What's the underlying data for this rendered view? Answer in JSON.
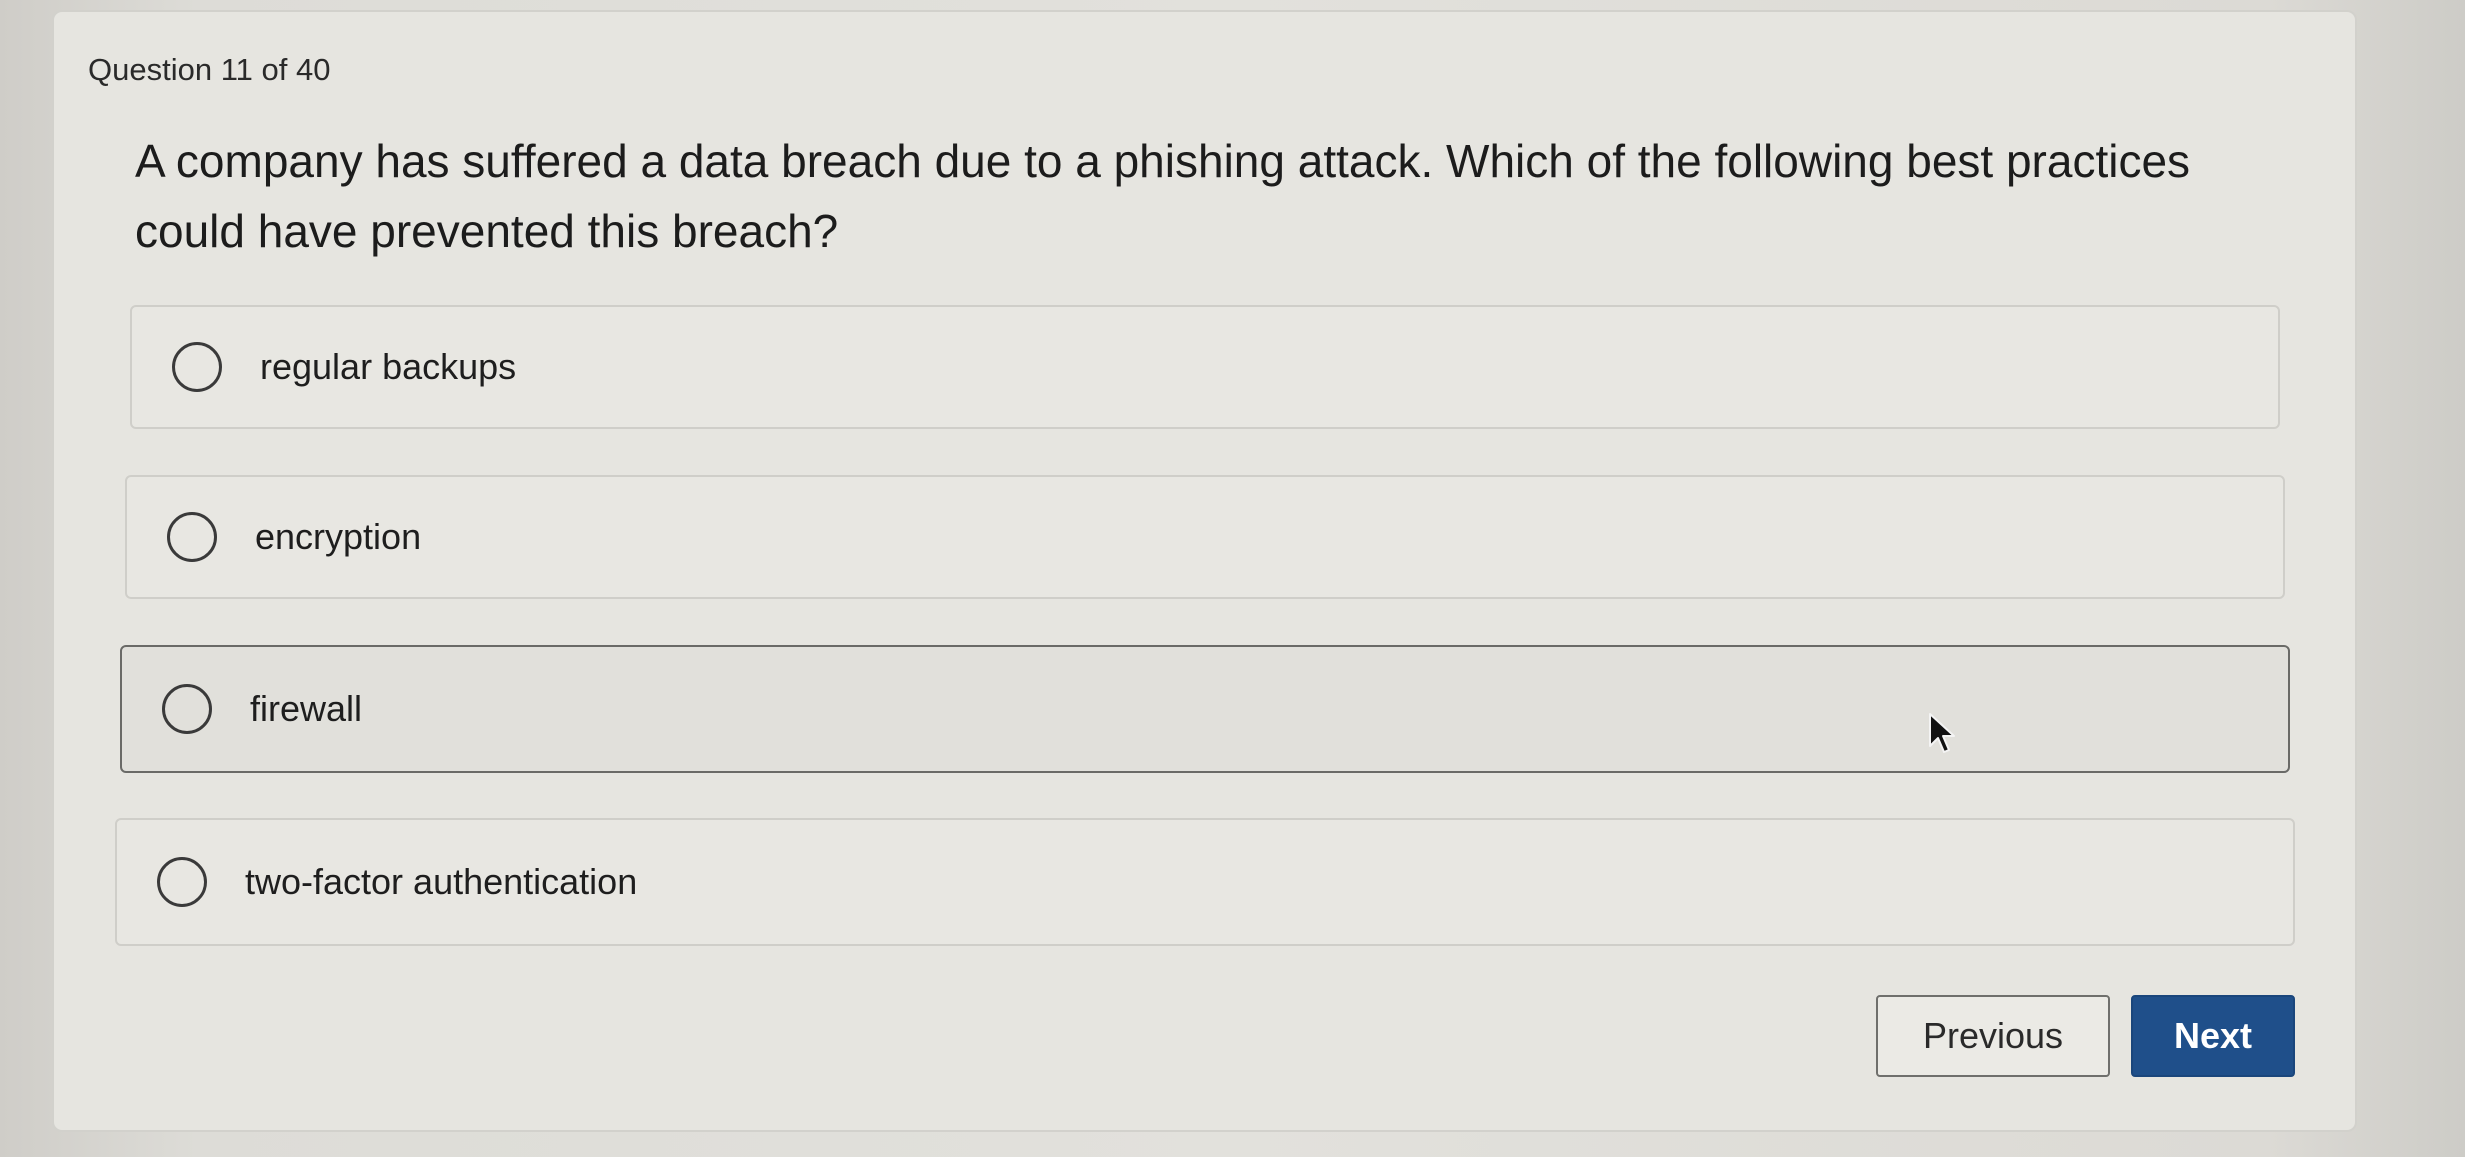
{
  "quiz": {
    "counter": "Question 11 of 40",
    "question": "A company has suffered a data breach due to a phishing attack. Which of the following best practices could have prevented this breach?",
    "options": [
      {
        "label": "regular backups"
      },
      {
        "label": "encryption"
      },
      {
        "label": "firewall"
      },
      {
        "label": "two-factor authentication"
      }
    ]
  },
  "nav": {
    "previous_label": "Previous",
    "next_label": "Next"
  },
  "colors": {
    "next_button": "#1f4f8a",
    "page_background": "#e6e5e0"
  },
  "icons": {
    "radio": "radio-unselected-icon",
    "cursor": "mouse-pointer-icon"
  }
}
